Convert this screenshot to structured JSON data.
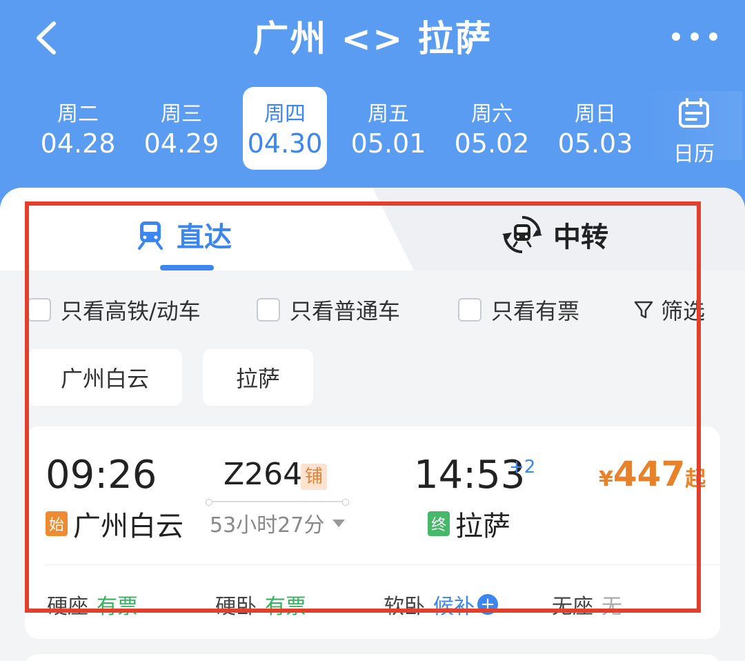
{
  "header": {
    "title": "广州 <> 拉萨",
    "back_icon": "chevron-left-icon",
    "more_icon": "more-dots-icon"
  },
  "dates": [
    {
      "weekday": "周二",
      "date": "04.28",
      "selected": false
    },
    {
      "weekday": "周三",
      "date": "04.29",
      "selected": false
    },
    {
      "weekday": "周四",
      "date": "04.30",
      "selected": true
    },
    {
      "weekday": "周五",
      "date": "05.01",
      "selected": false
    },
    {
      "weekday": "周六",
      "date": "05.02",
      "selected": false
    },
    {
      "weekday": "周日",
      "date": "05.03",
      "selected": false
    }
  ],
  "calendar": {
    "label": "日历",
    "icon": "calendar-icon"
  },
  "tabs": [
    {
      "label": "直达",
      "icon": "train-icon",
      "active": true
    },
    {
      "label": "中转",
      "icon": "transfer-train-icon",
      "active": false
    }
  ],
  "filters": [
    {
      "label": "只看高铁/动车",
      "checked": false
    },
    {
      "label": "只看普通车",
      "checked": false
    },
    {
      "label": "只看有票",
      "checked": false
    }
  ],
  "filter_button": {
    "label": "筛选",
    "icon": "funnel-icon"
  },
  "stations": [
    "广州白云",
    "拉萨"
  ],
  "train": {
    "departure_time": "09:26",
    "arrival_time": "14:53",
    "plus_days": "+2",
    "train_number": "Z264",
    "sleeper_badge": "铺",
    "duration": "53小时27分",
    "departure_tag": "始",
    "departure_station": "广州白云",
    "arrival_tag": "终",
    "arrival_station": "拉萨",
    "price_currency": "¥",
    "price_value": "447",
    "price_suffix": "起",
    "seats": [
      {
        "name": "硬座",
        "status": "有票"
      },
      {
        "name": "硬卧",
        "status": "有票"
      },
      {
        "name": "软卧",
        "status": "候补"
      },
      {
        "name": "无座",
        "status": "无"
      }
    ]
  },
  "colors": {
    "header_bg": "#5a9cf2",
    "accent_blue": "#3b86ef",
    "price_orange": "#e8822a",
    "available_green": "#32b45d",
    "highlight_red": "#e2402b"
  }
}
